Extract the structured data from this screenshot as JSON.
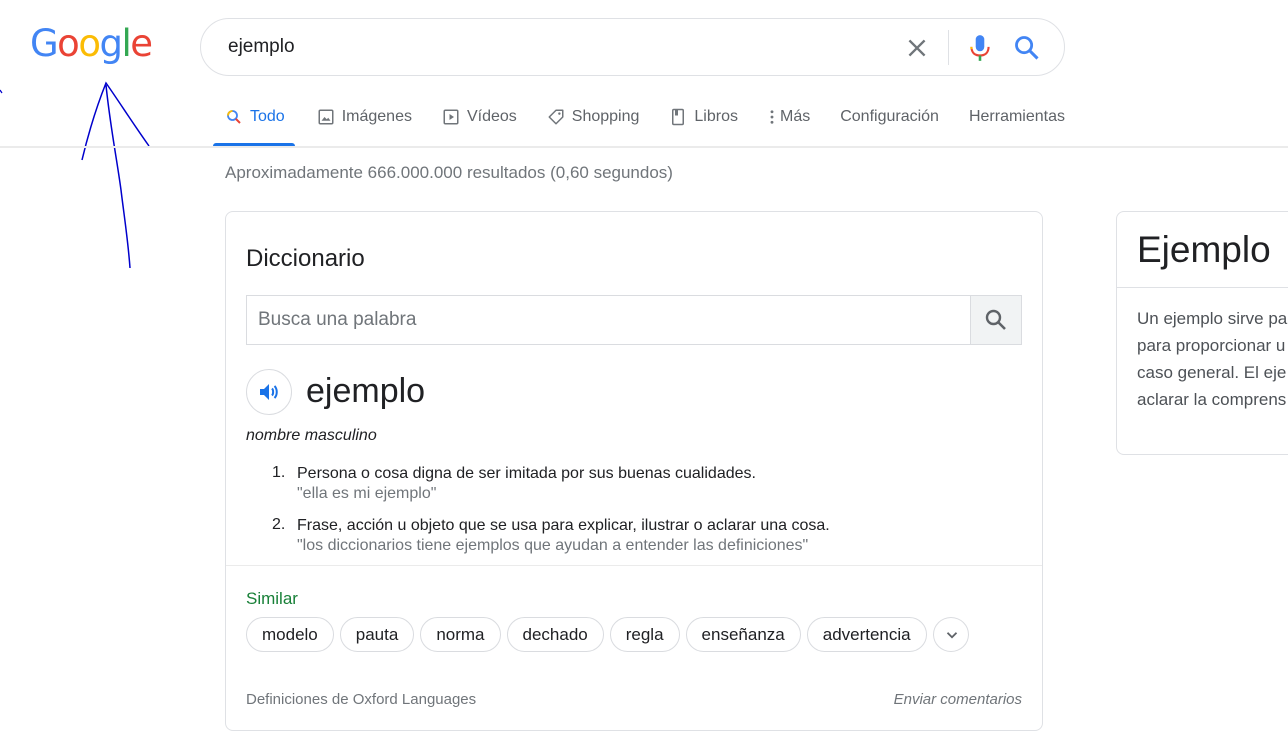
{
  "search": {
    "query": "ejemplo"
  },
  "tabs": [
    {
      "label": "Todo",
      "icon": "search-icon",
      "active": true
    },
    {
      "label": "Imágenes",
      "icon": "image-icon"
    },
    {
      "label": "Vídeos",
      "icon": "video-icon"
    },
    {
      "label": "Shopping",
      "icon": "tag-icon"
    },
    {
      "label": "Libros",
      "icon": "book-icon"
    },
    {
      "label": "Más",
      "icon": "more-vert-icon"
    },
    {
      "label": "Configuración"
    },
    {
      "label": "Herramientas"
    }
  ],
  "stats": "Aproximadamente 666.000.000 resultados (0,60 segundos)",
  "dictionary": {
    "title": "Diccionario",
    "search_placeholder": "Busca una palabra",
    "word": "ejemplo",
    "part_of_speech": "nombre masculino",
    "definitions": [
      {
        "num": "1.",
        "text": "Persona o cosa digna de ser imitada por sus buenas cualidades.",
        "example": "\"ella es mi ejemplo\""
      },
      {
        "num": "2.",
        "text": "Frase, acción u objeto que se usa para explicar, ilustrar o aclarar una cosa.",
        "example": "\"los diccionarios tiene ejemplos que ayudan a entender las definiciones\""
      }
    ],
    "similar_heading": "Similar",
    "similar": [
      "modelo",
      "pauta",
      "norma",
      "dechado",
      "regla",
      "enseñanza",
      "advertencia"
    ],
    "footer_source": "Definiciones de Oxford Languages",
    "footer_feedback": "Enviar comentarios"
  },
  "knowledge_panel": {
    "title": "Ejemplo",
    "description": [
      "Un ejemplo sirve pa",
      "para proporcionar u",
      "caso general. El eje",
      "aclarar la comprens"
    ]
  },
  "colors": {
    "accent": "#1a73e8",
    "similar_heading": "#188038",
    "annotation": "#0000cc",
    "logo": [
      "#4285f4",
      "#ea4335",
      "#fbbc05",
      "#4285f4",
      "#34a853",
      "#ea4335"
    ]
  }
}
